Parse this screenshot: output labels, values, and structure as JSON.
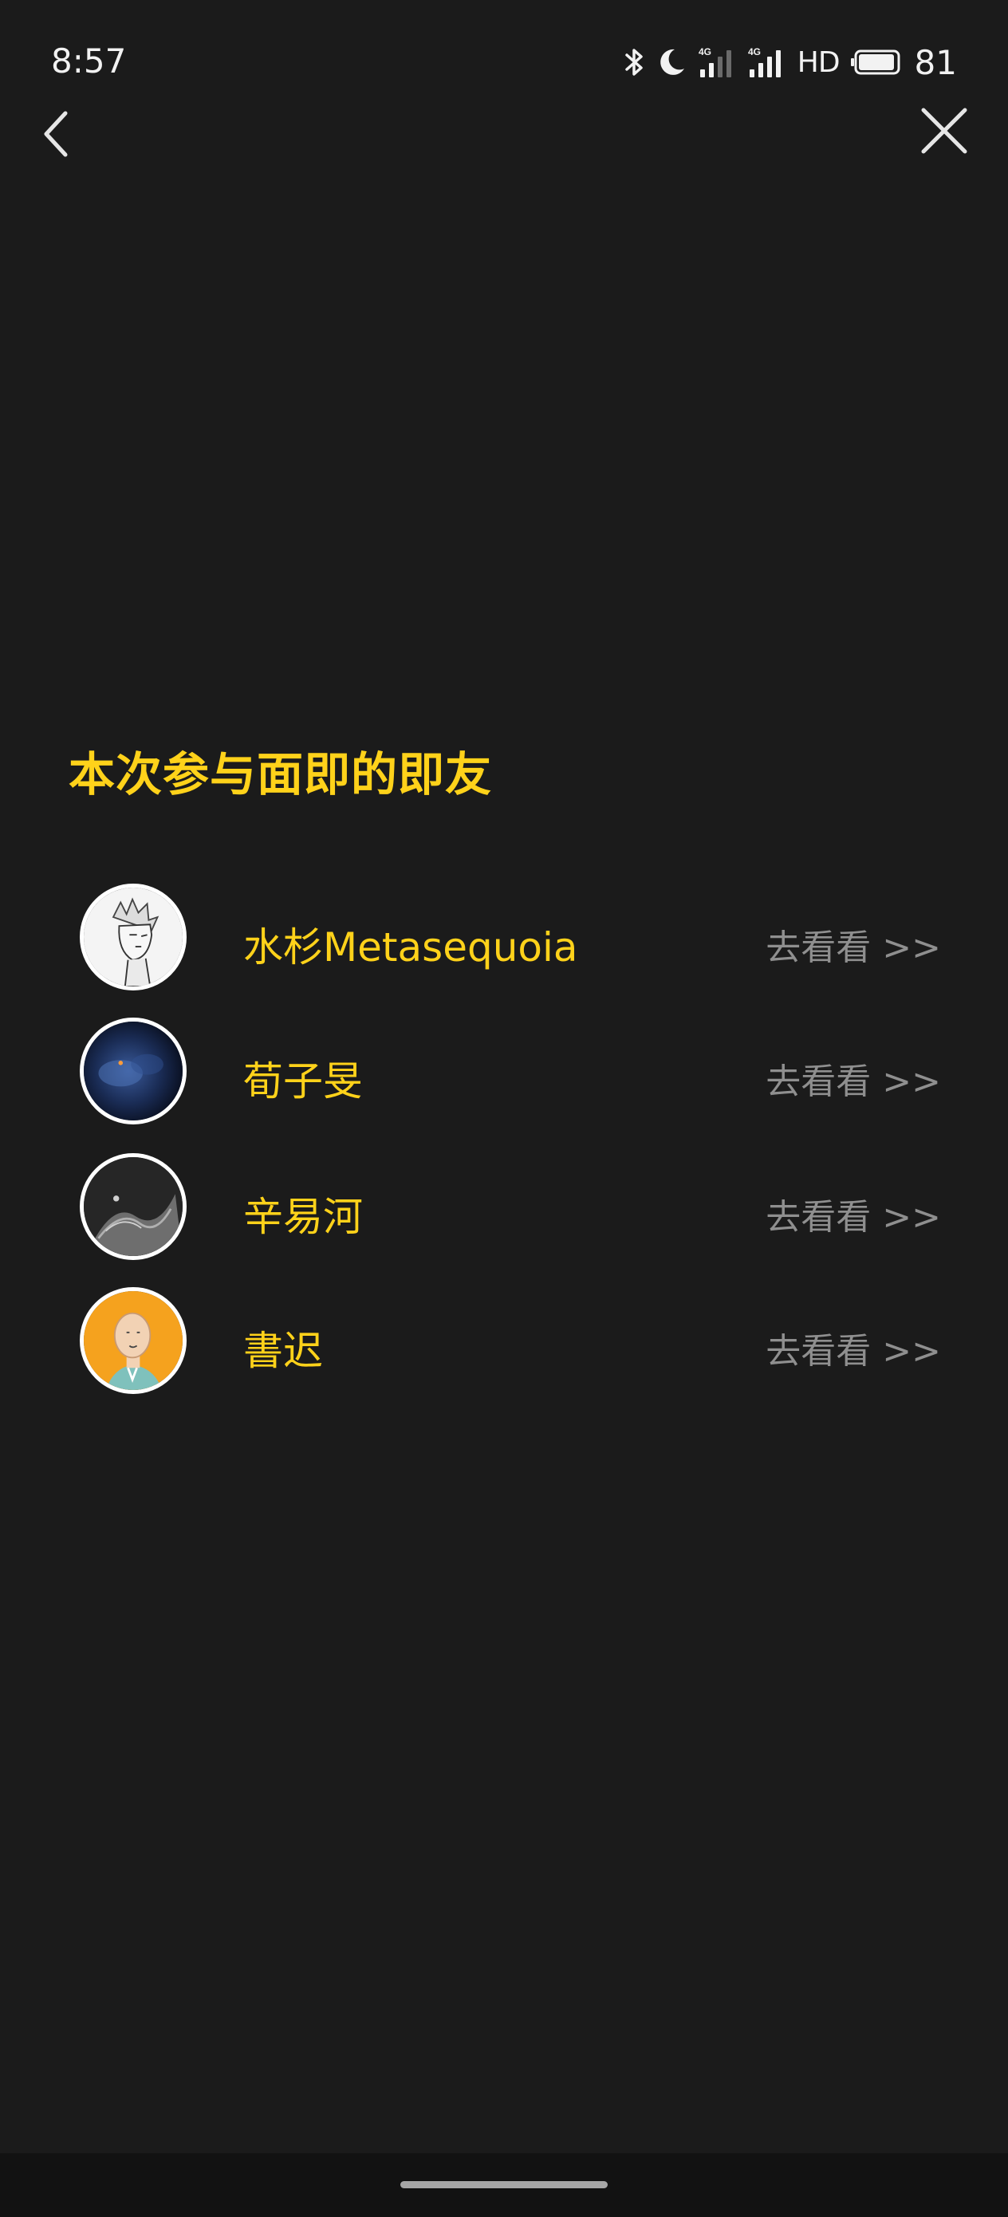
{
  "status_bar": {
    "time": "8:57",
    "hd_label": "HD",
    "battery_percent": "81",
    "icons": [
      "bluetooth-icon",
      "moon-icon",
      "signal-4g-icon",
      "signal-4g-icon",
      "hd-icon",
      "battery-icon"
    ]
  },
  "nav": {
    "back_icon": "chevron-left-icon",
    "close_icon": "close-icon"
  },
  "section": {
    "title": "本次参与面即的即友"
  },
  "users": [
    {
      "name": "水杉Metasequoia",
      "link": "去看看 >>",
      "avatar": "sketch-portrait"
    },
    {
      "name": "荀子旻",
      "link": "去看看 >>",
      "avatar": "night-sky"
    },
    {
      "name": "辛易河",
      "link": "去看看 >>",
      "avatar": "gray-texture"
    },
    {
      "name": "書迟",
      "link": "去看看 >>",
      "avatar": "cartoon-man-orange"
    }
  ],
  "colors": {
    "background": "#1b1b1b",
    "accent_yellow": "#ffd21a",
    "link_gray": "#8f8f8f"
  }
}
